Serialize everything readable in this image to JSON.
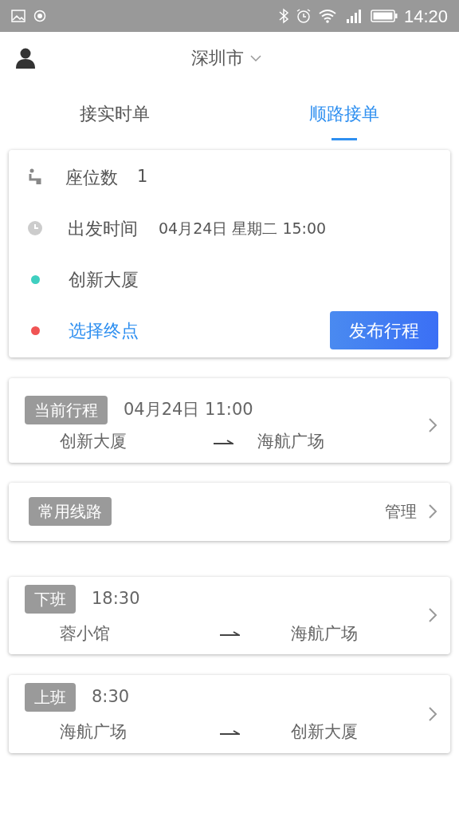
{
  "status_bar": {
    "time": "14:20"
  },
  "header": {
    "city": "深圳市"
  },
  "tabs": [
    {
      "label": "接实时单",
      "selected": false
    },
    {
      "label": "顺路接单",
      "selected": true
    }
  ],
  "form": {
    "seats_label": "座位数",
    "seats": "1",
    "time_label": "出发时间",
    "time": "04月24日 星期二 15:00",
    "points": [
      {
        "kind": "start",
        "label": "创新大厦",
        "color": "#3fcfc0"
      },
      {
        "kind": "end",
        "label": "选择终点",
        "color": "#f05454"
      }
    ],
    "publish": "发布行程"
  },
  "current_trip": {
    "tag": "当前行程",
    "time": "04月24日 11:00",
    "from": "创新大厦",
    "to": "海航广场"
  },
  "routes_header": {
    "tag": "常用线路",
    "action": "管理"
  },
  "routes": [
    {
      "tag": "下班",
      "time": "18:30",
      "from": "蓉小馆",
      "to": "海航广场"
    },
    {
      "tag": "上班",
      "time": "8:30",
      "from": "海航广场",
      "to": "创新大厦"
    }
  ]
}
